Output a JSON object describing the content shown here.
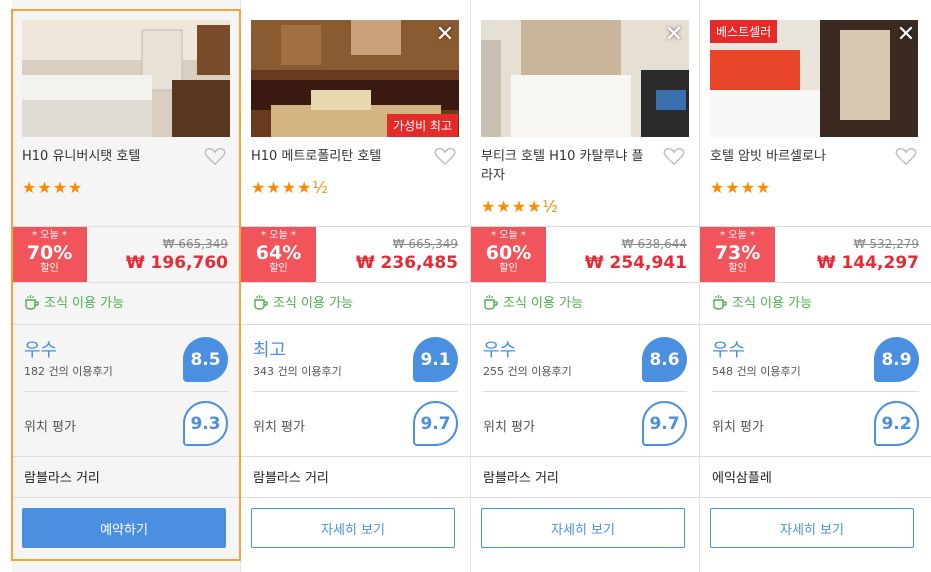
{
  "hotels": [
    {
      "name": "H10 유니버시탯 호텔",
      "stars": "★★★★",
      "badge": "",
      "discount_tag": "* 오늘 *",
      "discount_pct": "70%",
      "discount_label": "할인",
      "original_price": "₩ 665,349",
      "price": "₩ 196,760",
      "breakfast": "조식 이용 가능",
      "rating_text": "우수",
      "review_count": "182 건의 이용후기",
      "rating_score": "8.5",
      "location_label": "위치 평가",
      "location_score": "9.3",
      "area": "람블라스 거리",
      "button_label": "예약하기"
    },
    {
      "name": "H10 메트로폴리탄 호텔",
      "stars": "★★★★½",
      "badge": "가성비 최고",
      "discount_tag": "* 오늘 *",
      "discount_pct": "64%",
      "discount_label": "할인",
      "original_price": "₩ 665,349",
      "price": "₩ 236,485",
      "breakfast": "조식 이용 가능",
      "rating_text": "최고",
      "review_count": "343 건의 이용후기",
      "rating_score": "9.1",
      "location_label": "위치 평가",
      "location_score": "9.7",
      "area": "람블라스 거리",
      "button_label": "자세히 보기"
    },
    {
      "name": "부티크 호텔 H10 카탈루냐 플라자",
      "stars": "★★★★½",
      "badge": "",
      "discount_tag": "* 오늘 *",
      "discount_pct": "60%",
      "discount_label": "할인",
      "original_price": "₩ 638,644",
      "price": "₩ 254,941",
      "breakfast": "조식 이용 가능",
      "rating_text": "우수",
      "review_count": "255 건의 이용후기",
      "rating_score": "8.6",
      "location_label": "위치 평가",
      "location_score": "9.7",
      "area": "람블라스 거리",
      "button_label": "자세히 보기"
    },
    {
      "name": "호텔 암빗 바르셀로나",
      "stars": "★★★★",
      "badge": "베스트셀러",
      "discount_tag": "* 오늘 *",
      "discount_pct": "73%",
      "discount_label": "할인",
      "original_price": "₩ 532,279",
      "price": "₩ 144,297",
      "breakfast": "조식 이용 가능",
      "rating_text": "우수",
      "review_count": "548 건의 이용후기",
      "rating_score": "8.9",
      "location_label": "위치 평가",
      "location_score": "9.2",
      "area": "에익삼플레",
      "button_label": "자세히 보기"
    }
  ],
  "colors": {
    "accent": "#4a8fe0",
    "discount": "#f2545b",
    "price": "#e62b36",
    "selected_border": "#f7a437",
    "breakfast": "#4caf50",
    "star": "#ff8a00"
  },
  "icons": {
    "close": "close-icon",
    "heart": "heart-icon",
    "breakfast": "coffee-cup-icon"
  }
}
